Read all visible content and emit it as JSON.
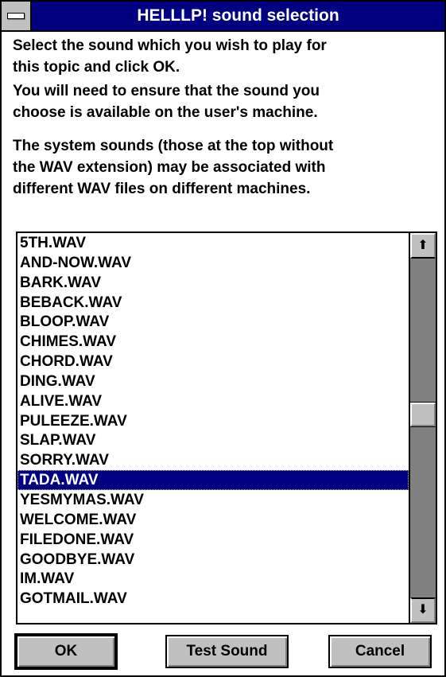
{
  "window": {
    "title": "HELLLP! sound selection"
  },
  "description": {
    "line1": "Select the sound which you wish to play for",
    "line2": "this topic and click OK.",
    "line3": "You will need to ensure that the sound you",
    "line4": "choose is available on the user's machine.",
    "line5": "The system sounds (those at the top without",
    "line6": "the WAV extension) may be associated with",
    "line7": "different WAV files on different machines."
  },
  "list": {
    "items": [
      "5TH.WAV",
      "AND-NOW.WAV",
      "BARK.WAV",
      "BEBACK.WAV",
      "BLOOP.WAV",
      "CHIMES.WAV",
      "CHORD.WAV",
      "DING.WAV",
      "ALIVE.WAV",
      "PULEEZE.WAV",
      "SLAP.WAV",
      "SORRY.WAV",
      "TADA.WAV",
      "YESMYMAS.WAV",
      "WELCOME.WAV",
      "FILEDONE.WAV",
      "GOODBYE.WAV",
      "IM.WAV",
      "GOTMAIL.WAV"
    ],
    "selected": "TADA.WAV"
  },
  "scrollbar": {
    "up_icon": "arrow-up-icon",
    "down_icon": "arrow-down-icon",
    "up_glyph": "⬆",
    "down_glyph": "⬇"
  },
  "buttons": {
    "ok": "OK",
    "test": "Test Sound",
    "cancel": "Cancel"
  },
  "colors": {
    "titlebar": "#000080",
    "selection": "#000080",
    "face": "#c0c0c0"
  }
}
